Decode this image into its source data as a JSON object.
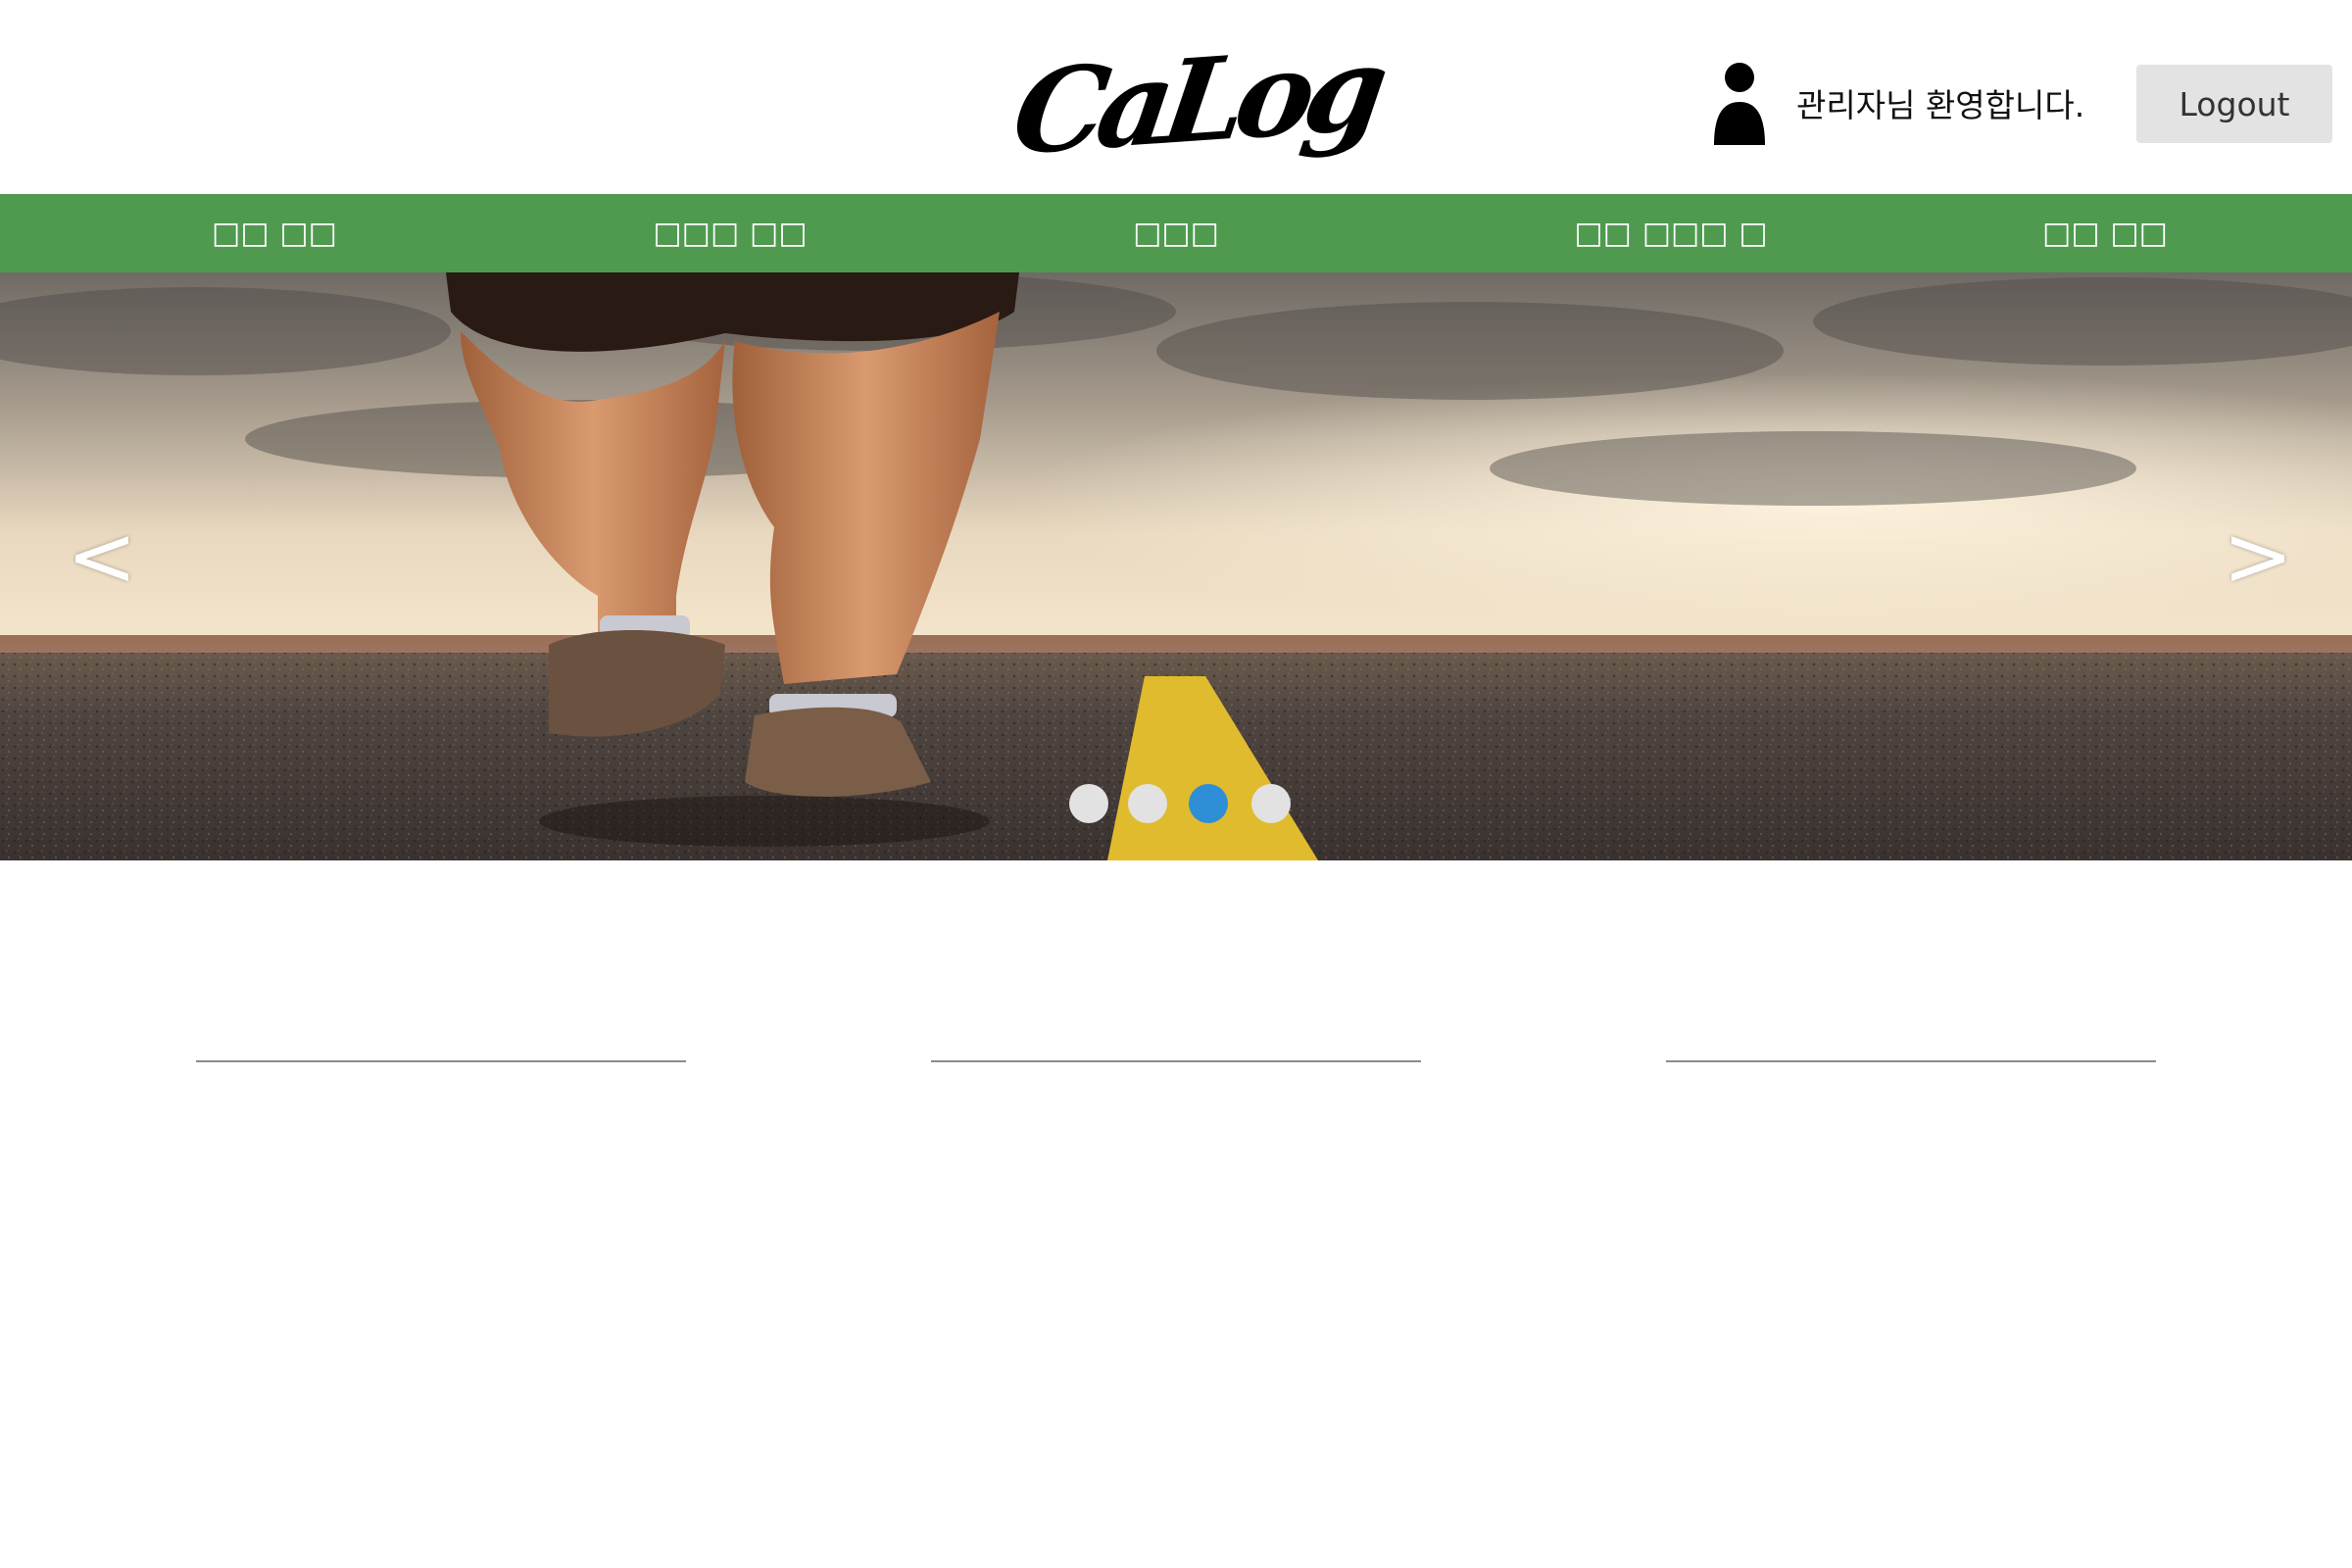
{
  "header": {
    "logo_text": "CaLog",
    "welcome_text": "관리자님 환영합니다.",
    "logout_label": "Logout"
  },
  "nav": {
    "items": [
      {
        "label": "□□ □□"
      },
      {
        "label": "□□□ □□"
      },
      {
        "label": "□□□"
      },
      {
        "label": "□□ □□□ □"
      },
      {
        "label": "□□ □□"
      }
    ]
  },
  "slider": {
    "prev_label": "<",
    "next_label": ">",
    "slide_count": 4,
    "active_index": 2,
    "dot_color": "#e2e2e2",
    "active_dot_color": "#2e8fd6"
  },
  "colors": {
    "nav_bg": "#4f9a4f",
    "logout_bg": "#e3e3e3"
  },
  "icons": {
    "user": "user-icon",
    "logo": "calog-logo"
  }
}
